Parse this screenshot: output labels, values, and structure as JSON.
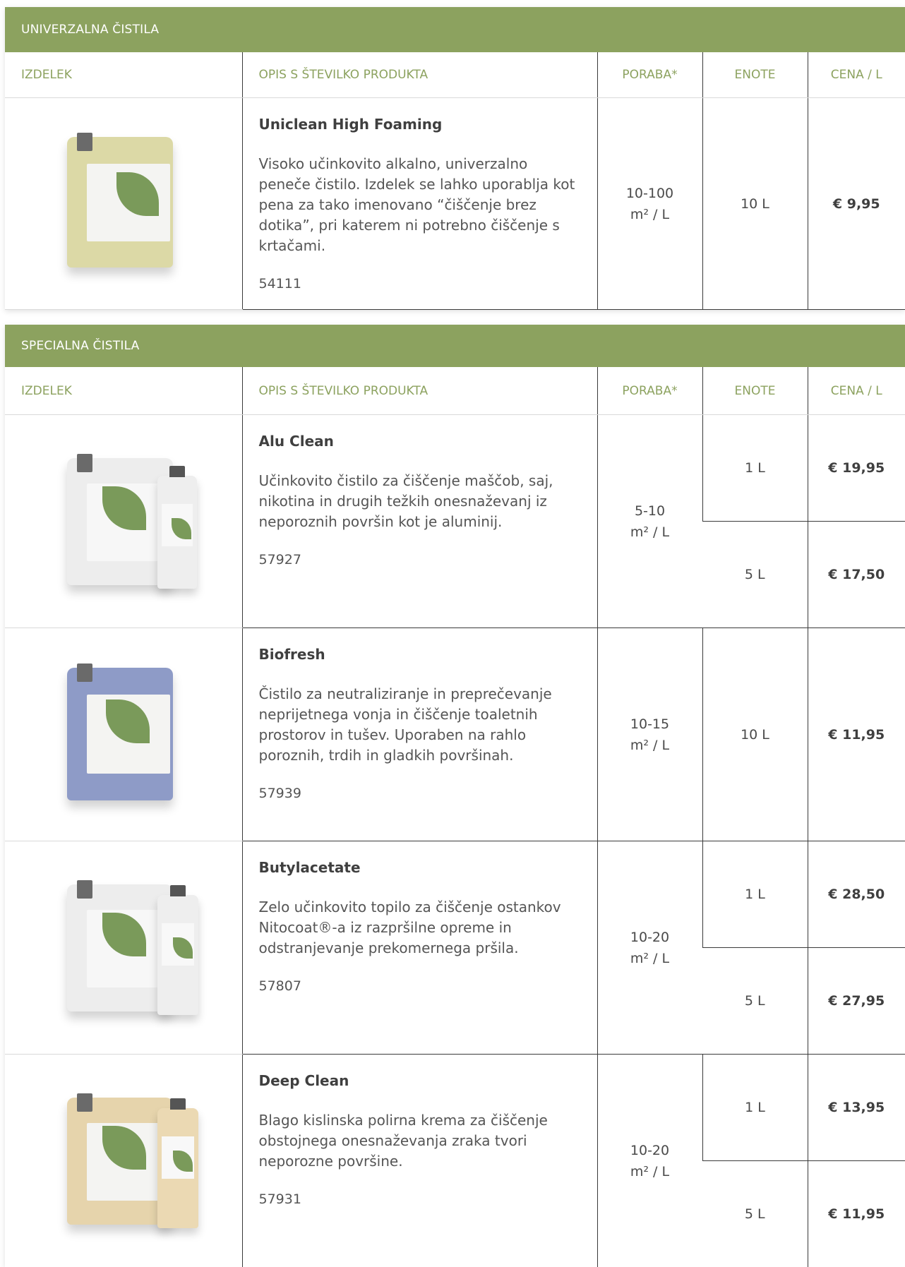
{
  "columns": {
    "product": "IZDELEK",
    "description": "OPIS S ŠTEVILKO PRODUKTA",
    "usage": "PORABA*",
    "units": "ENOTE",
    "price": "CENA / L"
  },
  "sections": [
    {
      "title": "UNIVERZALNA ČISTILA",
      "products": [
        {
          "name": "Uniclean High Foaming",
          "description": "Visoko učinkovito alkalno, univerzalno peneče čistilo. Izdelek se lahko uporablja kot pena za tako imenovano “čiščenje brez dotika”, pri katerem ni potrebno čiščenje s krtačami.",
          "number": "54111",
          "usage_value": "10-100",
          "usage_unit": "m² / L",
          "image_color": "#dcd9a6",
          "variants": [
            {
              "unit": "10 L",
              "price": "€ 9,95"
            }
          ]
        }
      ]
    },
    {
      "title": "SPECIALNA ČISTILA",
      "products": [
        {
          "name": "Alu Clean",
          "description": "Učinkovito čistilo za čiščenje maščob, saj, nikotina in drugih težkih onesnaževanj iz neporoznih površin kot je aluminij.",
          "number": "57927",
          "usage_value": "5-10",
          "usage_unit": "m² / L",
          "image_color": "#ededed",
          "variants": [
            {
              "unit": "1 L",
              "price": "€ 19,95"
            },
            {
              "unit": "5 L",
              "price": "€ 17,50"
            }
          ]
        },
        {
          "name": "Biofresh",
          "description": "Čistilo za neutraliziranje in preprečevanje neprijetnega vonja in čiščenje toaletnih prostorov in tušev. Uporaben na rahlo poroznih, trdih in gladkih površinah.",
          "number": "57939",
          "usage_value": "10-15",
          "usage_unit": "m² / L",
          "image_color": "#8e9bc7",
          "variants": [
            {
              "unit": "10 L",
              "price": "€ 11,95"
            }
          ]
        },
        {
          "name": "Butylacetate",
          "description": "Zelo učinkovito topilo za čiščenje ostankov Nitocoat®-a iz razpršilne opreme in odstranjevanje prekomernega pršila.",
          "number": "57807",
          "usage_value": "10-20",
          "usage_unit": "m² / L",
          "image_color": "#ededed",
          "variants": [
            {
              "unit": "1 L",
              "price": "€ 28,50"
            },
            {
              "unit": "5 L",
              "price": "€ 27,95"
            }
          ]
        },
        {
          "name": "Deep Clean",
          "description": "Blago kislinska polirna krema za čiščenje obstojnega onesnaževanja zraka tvori neporozne površine.",
          "number": "57931",
          "usage_value": "10-20",
          "usage_unit": "m² / L",
          "image_color": "#e6d4ac",
          "variants": [
            {
              "unit": "1 L",
              "price": "€ 13,95"
            },
            {
              "unit": "5 L",
              "price": "€ 11,95"
            }
          ]
        }
      ]
    }
  ]
}
